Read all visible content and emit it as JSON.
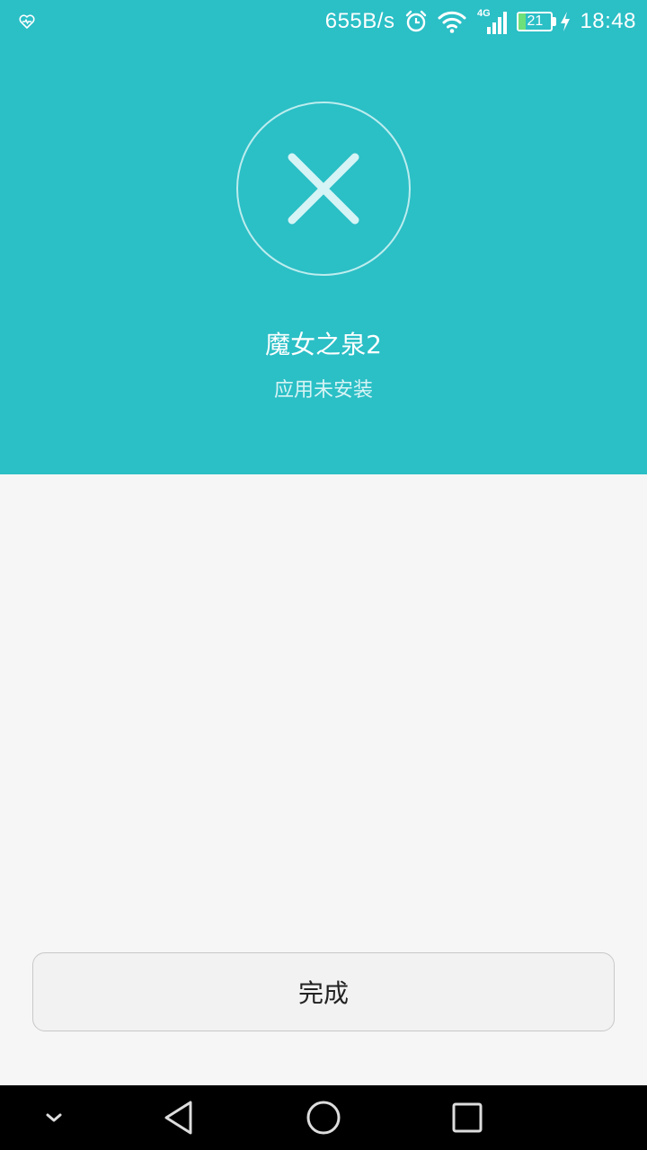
{
  "status_bar": {
    "net_speed": "655B/s",
    "signal_type": "4G",
    "battery_level": "21",
    "battery_fraction": 0.21,
    "time": "18:48",
    "icons": [
      "health-icon",
      "alarm-icon",
      "wifi-icon",
      "signal-icon",
      "battery-icon",
      "charging-icon"
    ]
  },
  "result": {
    "icon": "close-icon",
    "app_name": "魔女之泉2",
    "status": "应用未安装"
  },
  "actions": {
    "done_label": "完成"
  },
  "nav": {
    "icons": [
      "chevron-down-icon",
      "back-icon",
      "home-icon",
      "recents-icon"
    ]
  },
  "colors": {
    "header_bg": "#2bbfc6",
    "page_bg": "#f6f6f6",
    "battery_fill": "#6ee07a"
  }
}
